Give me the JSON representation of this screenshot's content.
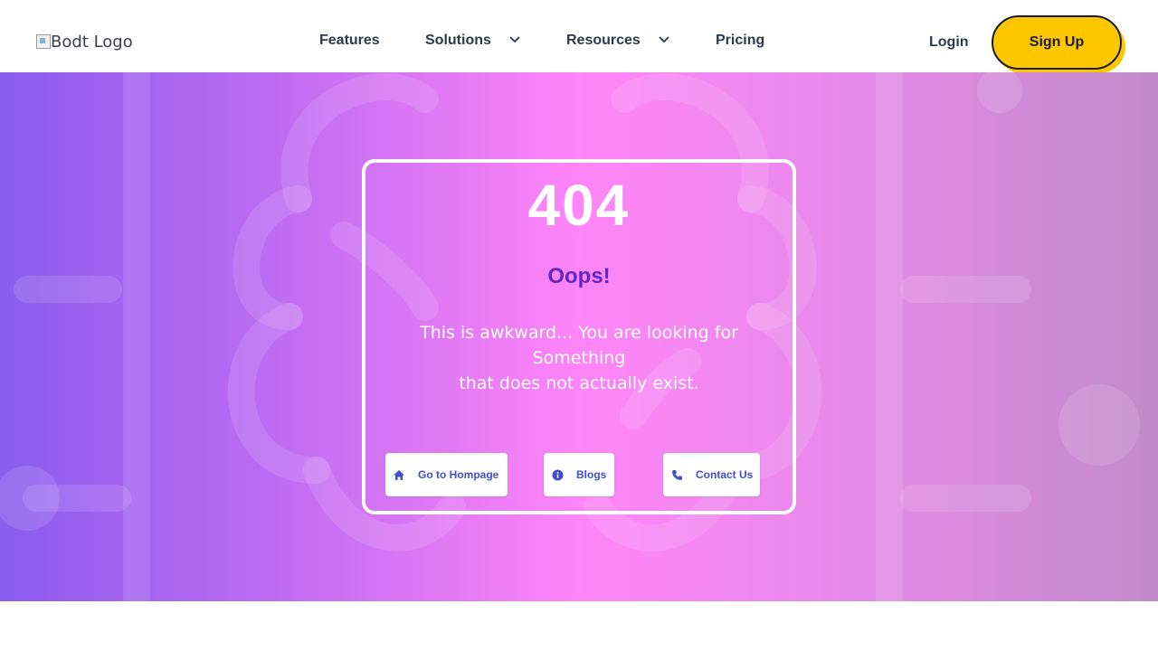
{
  "header": {
    "logo_alt": "Bodt Logo",
    "nav": [
      {
        "label": "Features",
        "dropdown": false
      },
      {
        "label": "Solutions",
        "dropdown": true
      },
      {
        "label": "Resources",
        "dropdown": true
      },
      {
        "label": "Pricing",
        "dropdown": false
      }
    ],
    "login_label": "Login",
    "signup_label": "Sign Up"
  },
  "error": {
    "code": "404",
    "heading": "Oops!",
    "message_line1": "This is awkward... You are looking for Something",
    "message_line2": "that does not actually exist."
  },
  "actions": [
    {
      "label": "Go to Hompage",
      "icon": "home-icon"
    },
    {
      "label": "Blogs",
      "icon": "info-icon"
    },
    {
      "label": "Contact Us",
      "icon": "phone-icon"
    }
  ],
  "colors": {
    "accent_yellow": "#ffc700",
    "heading_purple": "#6125c4",
    "button_text": "#3f4fcf",
    "nav_text": "#2c3a4e"
  }
}
